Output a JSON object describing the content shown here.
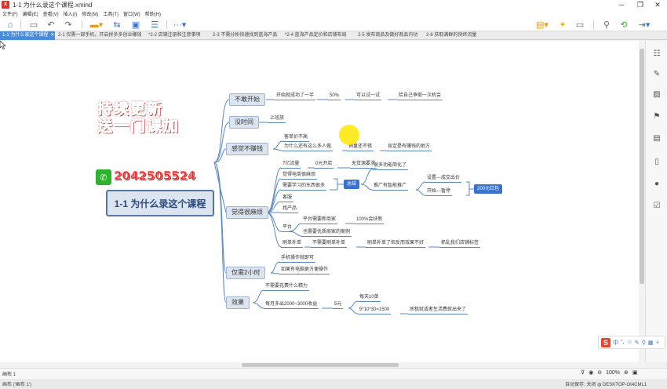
{
  "window": {
    "title": "1-1 为什么录这个课程.xmind",
    "logo": "X",
    "minimize": "─",
    "restore": "❐",
    "close": "✕"
  },
  "menu": [
    "文件(F)",
    "编辑(E)",
    "查看(V)",
    "插入(I)",
    "修改(M)",
    "工具(T)",
    "窗口(W)",
    "帮助(H)"
  ],
  "tabs": [
    {
      "label": "1-1 为什么录这个课程",
      "active": true
    },
    {
      "label": "2-1 仅需一部手机，开启拼多多创业赚钱",
      "active": false
    },
    {
      "label": "*2-2 店铺注册和注意事项",
      "active": false
    },
    {
      "label": "2-3 不需分析快速找到蓝海产品",
      "active": false
    },
    {
      "label": "*2-4 蓝海产品定价和店铺布局",
      "active": false
    },
    {
      "label": "2-5 发布商品及做好商品内功",
      "active": false
    },
    {
      "label": "2-6 获取满群的快终流量",
      "active": false
    }
  ],
  "tab_close": "✕",
  "promo": {
    "line1": "持续更新",
    "line2": "送一门课加",
    "number": "2042505524"
  },
  "mindmap": {
    "central": "1-1 为什么录这个课程",
    "branches": {
      "start": "不敢开始",
      "time": "没时间",
      "money": "感觉不赚钱",
      "trouble": "觉得很麻烦",
      "hours": "仅需2小时",
      "effect": "效果"
    },
    "leaves": {
      "start_1": "开始就成功了一半",
      "start_2": "50%",
      "start_3": "可以试一试",
      "start_4": "给自己争取一次机会",
      "time_1": "上班族",
      "money_1": "客单价不高",
      "money_2": "为什么还有这么多人做",
      "money_3": "销量还不错",
      "money_4": "肯定是有赚钱的地方",
      "trouble_1": "7亿流量",
      "trouble_2": "0元开店",
      "trouble_3": "无货源要求",
      "trouble_4": "觉得电商很麻烦",
      "trouble_5": "需要学习的东西很多",
      "trouble_sum": "总结",
      "trouble_6": "很多功能简化了",
      "trouble_7": "推广有智能推广",
      "trouble_8": "设置---成交出价",
      "trouble_9": "开始---暂停",
      "trouble_10": "200元红包",
      "trouble_11": "客服",
      "trouble_12": "找产品",
      "trouble_13": "平台",
      "trouble_14": "平台需要新商家",
      "trouble_15": "100%会扶新",
      "trouble_16": "也需要优质商家的案例",
      "trouble_17": "刷单补单",
      "trouble_18": "不需要刷单补单",
      "trouble_19": "刷单补单了但反而效果不好",
      "trouble_20": "抓乱我们店铺标签",
      "hours_1": "手机操作就即可",
      "hours_2": "如果有电脑更方便操作",
      "effect_1": "不需要花费什么精力",
      "effect_2": "每月多出2000~3000收益",
      "effect_3": "5元",
      "effect_4": "每天10单",
      "effect_5": "5*10*30=1500",
      "effect_6": "房租就或者生活费就出来了"
    }
  },
  "sheet": {
    "tab": "画布 1",
    "zoom": "100%"
  },
  "status": {
    "left": "画布 ('画布 1')",
    "autosave": "自动保存: 关闭",
    "computer": "DESKTOP-OI4CML1"
  },
  "ime": {
    "logo": "S",
    "items": [
      "中",
      "°,",
      "☺",
      "✎",
      "⚲",
      "▦",
      "⚡"
    ]
  },
  "colors": {
    "accent": "#4a8bd8",
    "branch_line": "#5b88c0",
    "highlight": "#3a72d0",
    "promo": "#ff2020"
  }
}
